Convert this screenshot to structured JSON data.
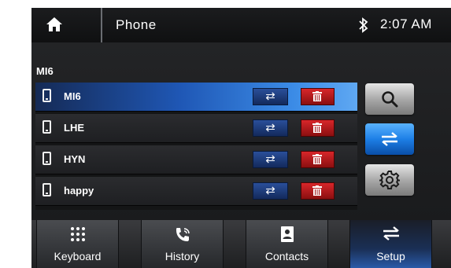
{
  "header": {
    "title": "Phone",
    "time": "2:07 AM"
  },
  "device": {
    "current_name": "MI6"
  },
  "paired_devices": [
    {
      "name": "MI6",
      "selected": true
    },
    {
      "name": "LHE",
      "selected": false
    },
    {
      "name": "HYN",
      "selected": false
    },
    {
      "name": "happy",
      "selected": false
    }
  ],
  "bottom_tabs": [
    {
      "label": "Keyboard",
      "icon": "keypad-icon"
    },
    {
      "label": "History",
      "icon": "call-history-icon"
    },
    {
      "label": "Contacts",
      "icon": "contacts-icon"
    },
    {
      "label": "Setup",
      "icon": "swap-arrows-icon",
      "active": true
    }
  ],
  "colors": {
    "accent_blue": "#1d7fe6",
    "delete_red": "#c81e22",
    "background": "#0b0b0c"
  }
}
